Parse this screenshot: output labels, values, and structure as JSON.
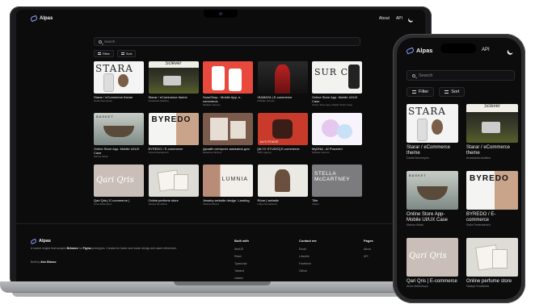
{
  "laptop": {
    "brand": "Alpas",
    "nav": {
      "about": "About",
      "api": "API"
    },
    "search_placeholder": "Search",
    "filter_label": "Filter",
    "sort_label": "Sort",
    "cards": [
      {
        "title": "Starar / eCommerce theme",
        "author": "Dariia Nesmeyan",
        "thumb": "stara",
        "thumb_text": "STARA"
      },
      {
        "title": "Starar / eCommerce theme",
        "author": "Anastasiia Akatiina",
        "thumb": "scene",
        "thumb_text": "Sclever"
      },
      {
        "title": "ScanShop - Mobile App, e-commerce",
        "author": "Multiple Owners",
        "thumb": "red",
        "thumb_text": ""
      },
      {
        "title": "ISAMAYA | E-commerce",
        "author": "Multiple Owners",
        "thumb": "isa",
        "thumb_text": ""
      },
      {
        "title": "Online Store App- Mobile UI/UX Case",
        "author": "Online Store App- Mobile UI/UX Case",
        "thumb": "surf",
        "thumb_text": "SUR CA"
      },
      {
        "title": "Online Store App- Mobile UI/UX Case",
        "author": "Marina Kibak",
        "thumb": "basket",
        "thumb_text": "BASKET"
      },
      {
        "title": "BYREDO / E-commerce",
        "author": "Sofia Pankratevich",
        "thumb": "byredo",
        "thumb_text": "BYREDO"
      },
      {
        "title": "Дизайн интернет-магазина для",
        "author": "Ekaterina Shilova",
        "thumb": "brown",
        "thumb_text": ""
      },
      {
        "title": "[ALYX STUDIO] E-commerce",
        "author": "SMC Agency",
        "thumb": "alyx",
        "thumb_text": "ALYX STUDIO"
      },
      {
        "title": "MyDNA - AI Powered",
        "author": "Multiple Owners",
        "thumb": "mydna",
        "thumb_text": ""
      },
      {
        "title": "Qari Qris | E-commerce |",
        "author": "Arina Meleshuyo",
        "thumb": "qari",
        "thumb_text": "Qari Qris"
      },
      {
        "title": "Online perfume store",
        "author": "Nastya Smolkinta",
        "thumb": "perf",
        "thumb_text": ""
      },
      {
        "title": "Jewelry website design. Landing",
        "author": "Tatiana Maroof",
        "thumb": "lumnia",
        "thumb_text": "LUMNIA"
      },
      {
        "title": "Rône | website",
        "author": "Lidiya Gunashova",
        "thumb": "rone",
        "thumb_text": ""
      },
      {
        "title": "Title",
        "author": "Owner",
        "thumb": "stella",
        "thumb_text": "STELLA McCARTNEY"
      }
    ],
    "footer": {
      "brand": "Alpas",
      "desc_pre": "A search engine that scrapes ",
      "desc_b1": "Behance",
      "desc_mid": " for ",
      "desc_b2": "Figma",
      "desc_post": " prototypes. Created for faster and easier design and asset references.",
      "built_by_label": "Built by",
      "built_by_name": "Alec Bianco",
      "columns": [
        {
          "heading": "Built with",
          "links": [
            "NextJS",
            "React",
            "Typescript",
            "Tailwind",
            "shadcn"
          ]
        },
        {
          "heading": "Contact me",
          "links": [
            "Email",
            "LinkedIn",
            "Facebook",
            "Github"
          ]
        },
        {
          "heading": "Pages",
          "links": [
            "About",
            "API"
          ]
        }
      ]
    }
  },
  "phone": {
    "brand": "Alpas",
    "nav_api": "API",
    "search_placeholder": "Search",
    "filter_label": "Filter",
    "sort_label": "Sort",
    "cards": [
      {
        "title": "Starar / eCommerce theme",
        "author": "Dariia Nesmeyan",
        "thumb": "stara",
        "thumb_text": "STARA"
      },
      {
        "title": "Starar / eCommerce theme",
        "author": "Anastasiia Akatiina",
        "thumb": "scene",
        "thumb_text": "Sclever"
      },
      {
        "title": "Online Store App- Mobile UI/UX Case",
        "author": "Marina Kibak",
        "thumb": "basket",
        "thumb_text": "BASKET"
      },
      {
        "title": "BYREDO / E-commerce",
        "author": "Sofia Pankratevich",
        "thumb": "byredo",
        "thumb_text": "BYREDO"
      },
      {
        "title": "Qari Qris | E-commerce",
        "author": "Arina Meleshuyo",
        "thumb": "qari",
        "thumb_text": "Qari Qris"
      },
      {
        "title": "Online perfume store",
        "author": "Nastya Smolkinta",
        "thumb": "perf",
        "thumb_text": ""
      }
    ]
  },
  "colors": {
    "accent": "#8ea4ff",
    "background": "#0c0c0d",
    "text": "#f0f0f0",
    "muted": "#8d8d92"
  },
  "icons": [
    "logo-icon",
    "moon-icon",
    "search-icon",
    "filter-icon",
    "sort-icon"
  ]
}
